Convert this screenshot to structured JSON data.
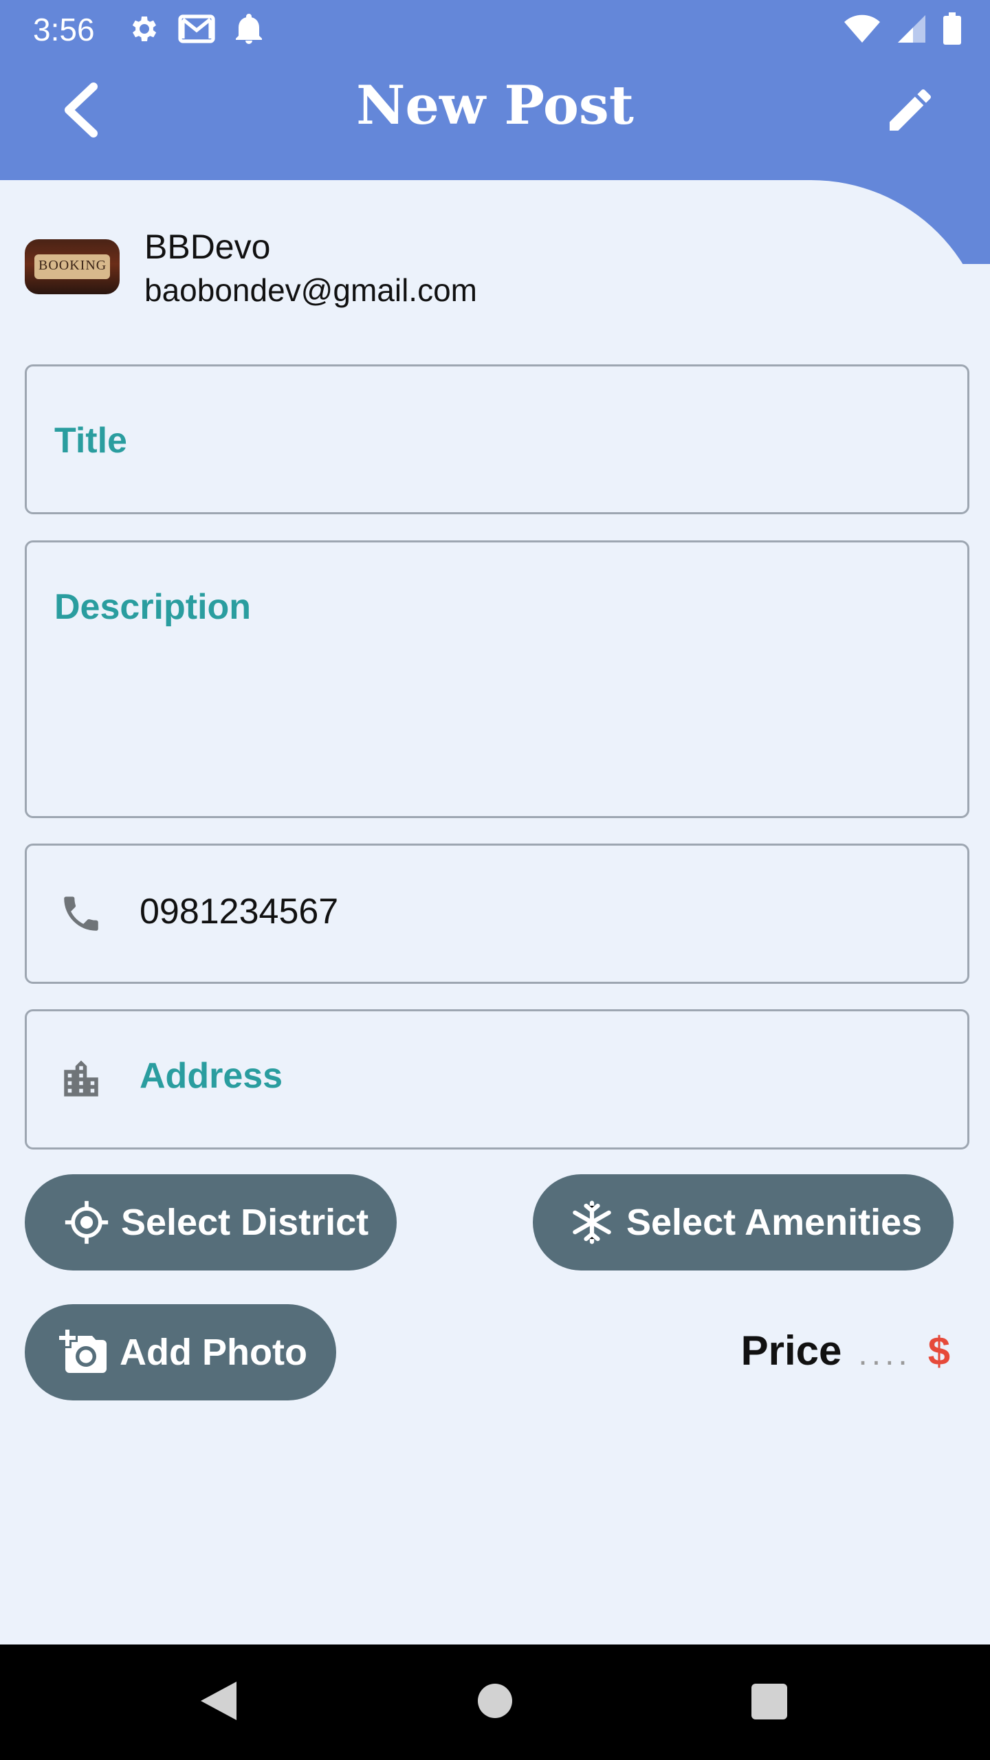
{
  "status_bar": {
    "time": "3:56",
    "icons_left": [
      "gear-icon",
      "gmail-icon",
      "bell-icon"
    ],
    "icons_right": [
      "wifi-icon",
      "signal-icon",
      "battery-icon"
    ]
  },
  "app_bar": {
    "title": "New Post",
    "back_icon": "chevron-left-icon",
    "action_icon": "pencil-icon",
    "color": "#6487d9"
  },
  "user": {
    "name": "BBDevo",
    "email": "baobondev@gmail.com",
    "avatar_text": "BOOKING"
  },
  "form": {
    "title_label": "Title",
    "description_label": "Description",
    "phone_value": "0981234567",
    "phone_icon": "phone-icon",
    "address_label": "Address",
    "address_icon": "building-icon"
  },
  "buttons": {
    "select_district": "Select District",
    "select_amenities": "Select Amenities",
    "add_photo": "Add Photo"
  },
  "price": {
    "label": "Price",
    "placeholder": "....",
    "currency": "$"
  },
  "colors": {
    "accent": "#6487d9",
    "label_teal": "#2a9d9f",
    "button_slate": "#566e7a",
    "currency_red": "#e64a3a",
    "background": "#ecf2fb"
  },
  "nav_bar": {
    "icons": [
      "nav-back-icon",
      "nav-home-icon",
      "nav-recents-icon"
    ]
  }
}
